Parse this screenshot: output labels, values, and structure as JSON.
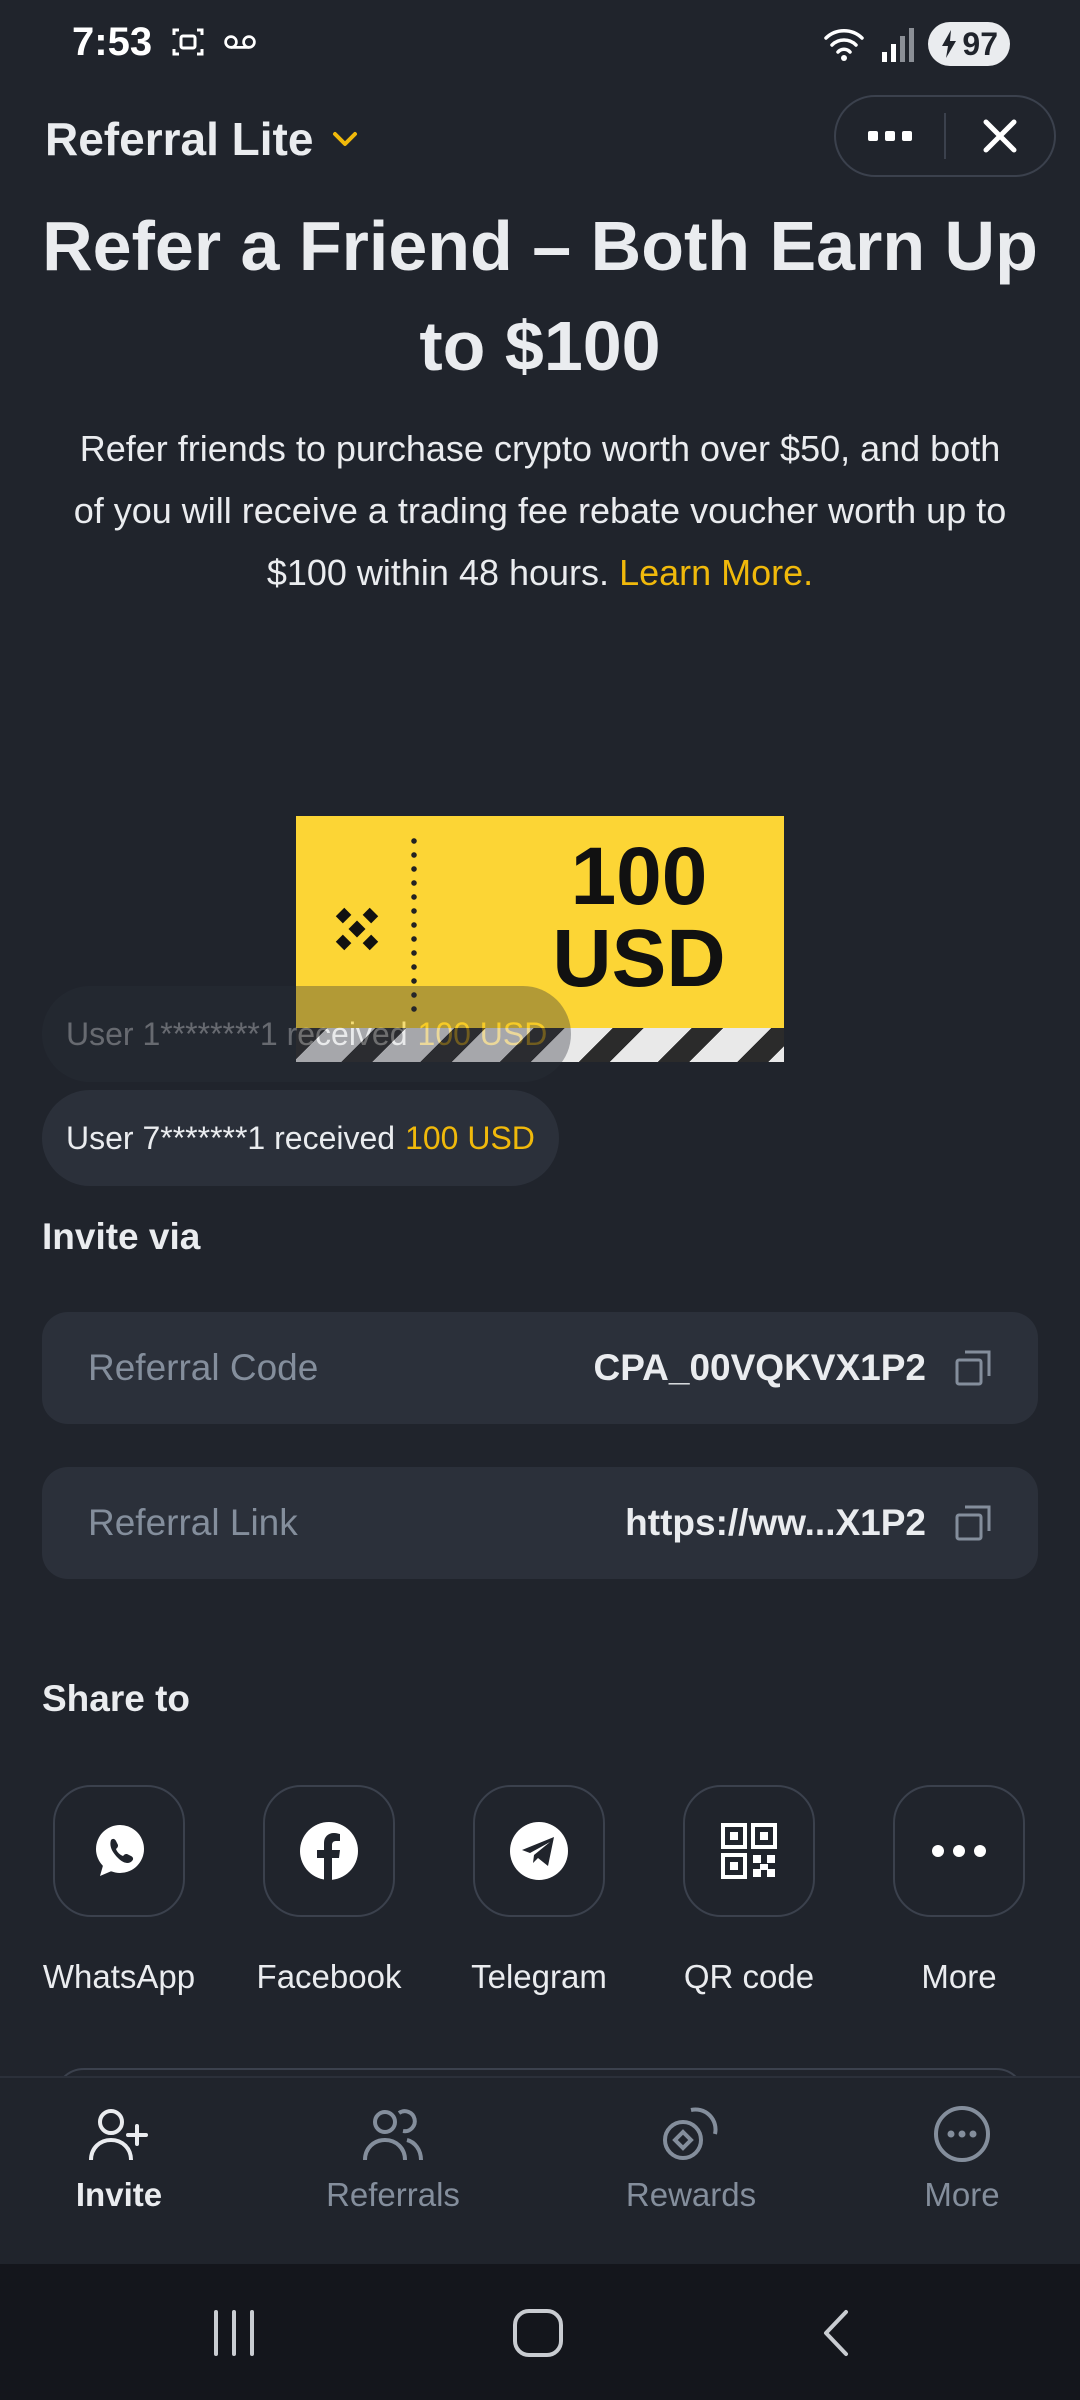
{
  "status_bar": {
    "time": "7:53",
    "battery": "97"
  },
  "header": {
    "title": "Referral Lite"
  },
  "hero": {
    "title": "Refer a Friend – Both Earn Up to $100",
    "description": "Refer friends to purchase crypto worth over $50, and both of you will receive a trading fee rebate voucher worth up to $100 within 48 hours.",
    "learn_more": "Learn More."
  },
  "voucher": {
    "amount": "100",
    "currency": "USD"
  },
  "toasts": [
    {
      "user": "User 1********1 received",
      "amount": "100 USD"
    },
    {
      "user": "User 7*******1 received",
      "amount": "100 USD"
    }
  ],
  "invite": {
    "label": "Invite via",
    "referral_code": {
      "label": "Referral Code",
      "value": "CPA_00VQKVX1P2"
    },
    "referral_link": {
      "label": "Referral Link",
      "value": "https://ww...X1P2"
    }
  },
  "share": {
    "label": "Share to",
    "items": [
      {
        "label": "WhatsApp",
        "icon": "whatsapp-icon"
      },
      {
        "label": "Facebook",
        "icon": "facebook-icon"
      },
      {
        "label": "Telegram",
        "icon": "telegram-icon"
      },
      {
        "label": "QR code",
        "icon": "qr-code-icon"
      },
      {
        "label": "More",
        "icon": "more-dots-icon"
      }
    ]
  },
  "bottom_nav": {
    "items": [
      {
        "label": "Invite",
        "active": true
      },
      {
        "label": "Referrals"
      },
      {
        "label": "Rewards"
      },
      {
        "label": "More"
      }
    ]
  },
  "colors": {
    "background": "#20242c",
    "accent": "#f0b90b",
    "voucher": "#fcd535",
    "card": "#2b303a",
    "muted": "#848e9c"
  }
}
